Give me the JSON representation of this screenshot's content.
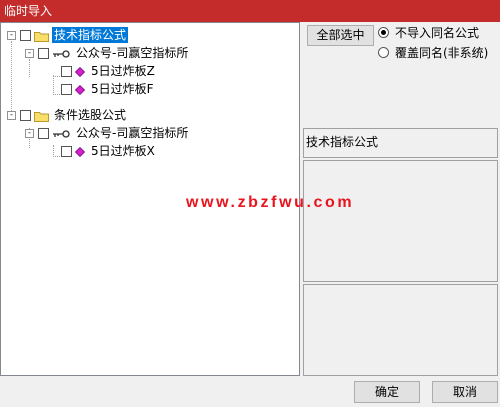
{
  "window": {
    "title": "临时导入",
    "title_bar_color": "#c42b2b"
  },
  "tree": {
    "nodes": [
      {
        "label": "技术指标公式",
        "type": "folder",
        "expander": "-",
        "selected": true
      },
      {
        "label": "公众号-司赢空指标所",
        "type": "key",
        "expander": "-"
      },
      {
        "label": "5日过炸板Z",
        "type": "formula"
      },
      {
        "label": "5日过炸板F",
        "type": "formula"
      },
      {
        "label": "条件选股公式",
        "type": "folder",
        "expander": "-"
      },
      {
        "label": "公众号-司赢空指标所",
        "type": "key",
        "expander": "-"
      },
      {
        "label": "5日过炸板X",
        "type": "formula"
      }
    ],
    "selection_color": "#0078d7"
  },
  "options": {
    "select_all_label": "全部选中",
    "radio_no_import": "不导入同名公式",
    "radio_overwrite": "覆盖同名(非系统)",
    "selected_radio": "radio_no_import"
  },
  "info": {
    "category_text": "技术指标公式"
  },
  "watermark": {
    "text": "www.zbzfwu.com",
    "color": "#e8141e"
  },
  "footer": {
    "ok_label": "确定",
    "cancel_label": "取消"
  }
}
